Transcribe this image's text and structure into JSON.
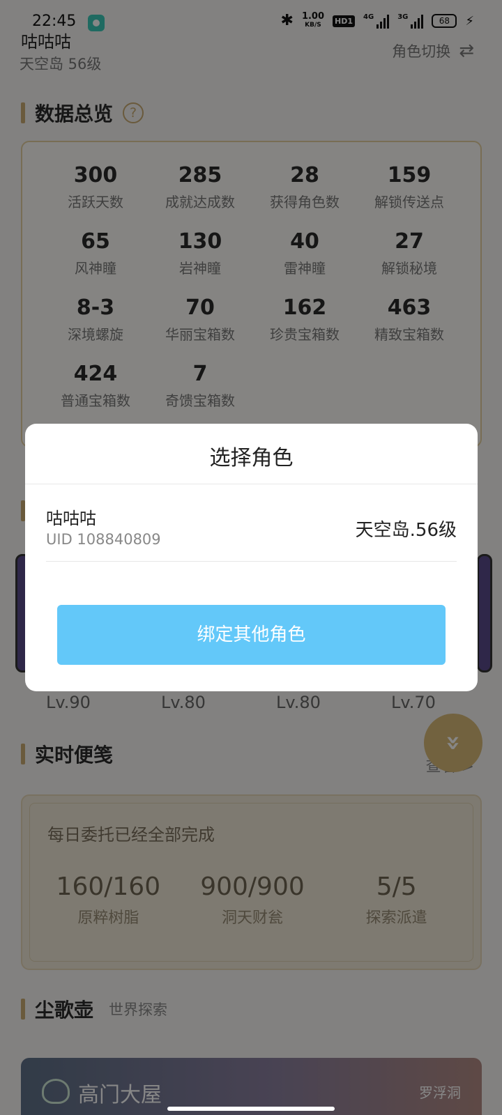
{
  "status_bar": {
    "time": "22:45",
    "speed_value": "1.00",
    "speed_unit": "KB/S",
    "hd_label": "HD1",
    "sig1_label": "4G",
    "sig2_label": "3G",
    "battery": "68"
  },
  "header": {
    "nickname": "咕咕咕",
    "server_level": "天空岛 56级",
    "switch_label": "角色切换"
  },
  "overview": {
    "title": "数据总览",
    "stats": [
      {
        "value": "300",
        "label": "活跃天数"
      },
      {
        "value": "285",
        "label": "成就达成数"
      },
      {
        "value": "28",
        "label": "获得角色数"
      },
      {
        "value": "159",
        "label": "解锁传送点"
      },
      {
        "value": "65",
        "label": "风神瞳"
      },
      {
        "value": "130",
        "label": "岩神瞳"
      },
      {
        "value": "40",
        "label": "雷神瞳"
      },
      {
        "value": "27",
        "label": "解锁秘境"
      },
      {
        "value": "8-3",
        "label": "深境螺旋"
      },
      {
        "value": "70",
        "label": "华丽宝箱数"
      },
      {
        "value": "162",
        "label": "珍贵宝箱数"
      },
      {
        "value": "463",
        "label": "精致宝箱数"
      },
      {
        "value": "424",
        "label": "普通宝箱数"
      },
      {
        "value": "7",
        "label": "奇馈宝箱数"
      }
    ]
  },
  "characters": {
    "levels": [
      "Lv.90",
      "Lv.80",
      "Lv.80",
      "Lv.70"
    ]
  },
  "notes": {
    "title": "实时便笺",
    "more": "查看 >",
    "headline": "每日委托已经全部完成",
    "items": [
      {
        "value": "160/160",
        "label": "原粹树脂"
      },
      {
        "value": "900/900",
        "label": "洞天财瓮"
      },
      {
        "value": "5/5",
        "label": "探索派遣"
      }
    ]
  },
  "teapot": {
    "title": "尘歌壶",
    "subtitle": "世界探索",
    "name": "高门大屋",
    "place": "罗浮洞"
  },
  "dialog": {
    "title": "选择角色",
    "role": {
      "name": "咕咕咕",
      "uid": "UID 108840809",
      "server": "天空岛.56级"
    },
    "bind_button": "绑定其他角色"
  }
}
